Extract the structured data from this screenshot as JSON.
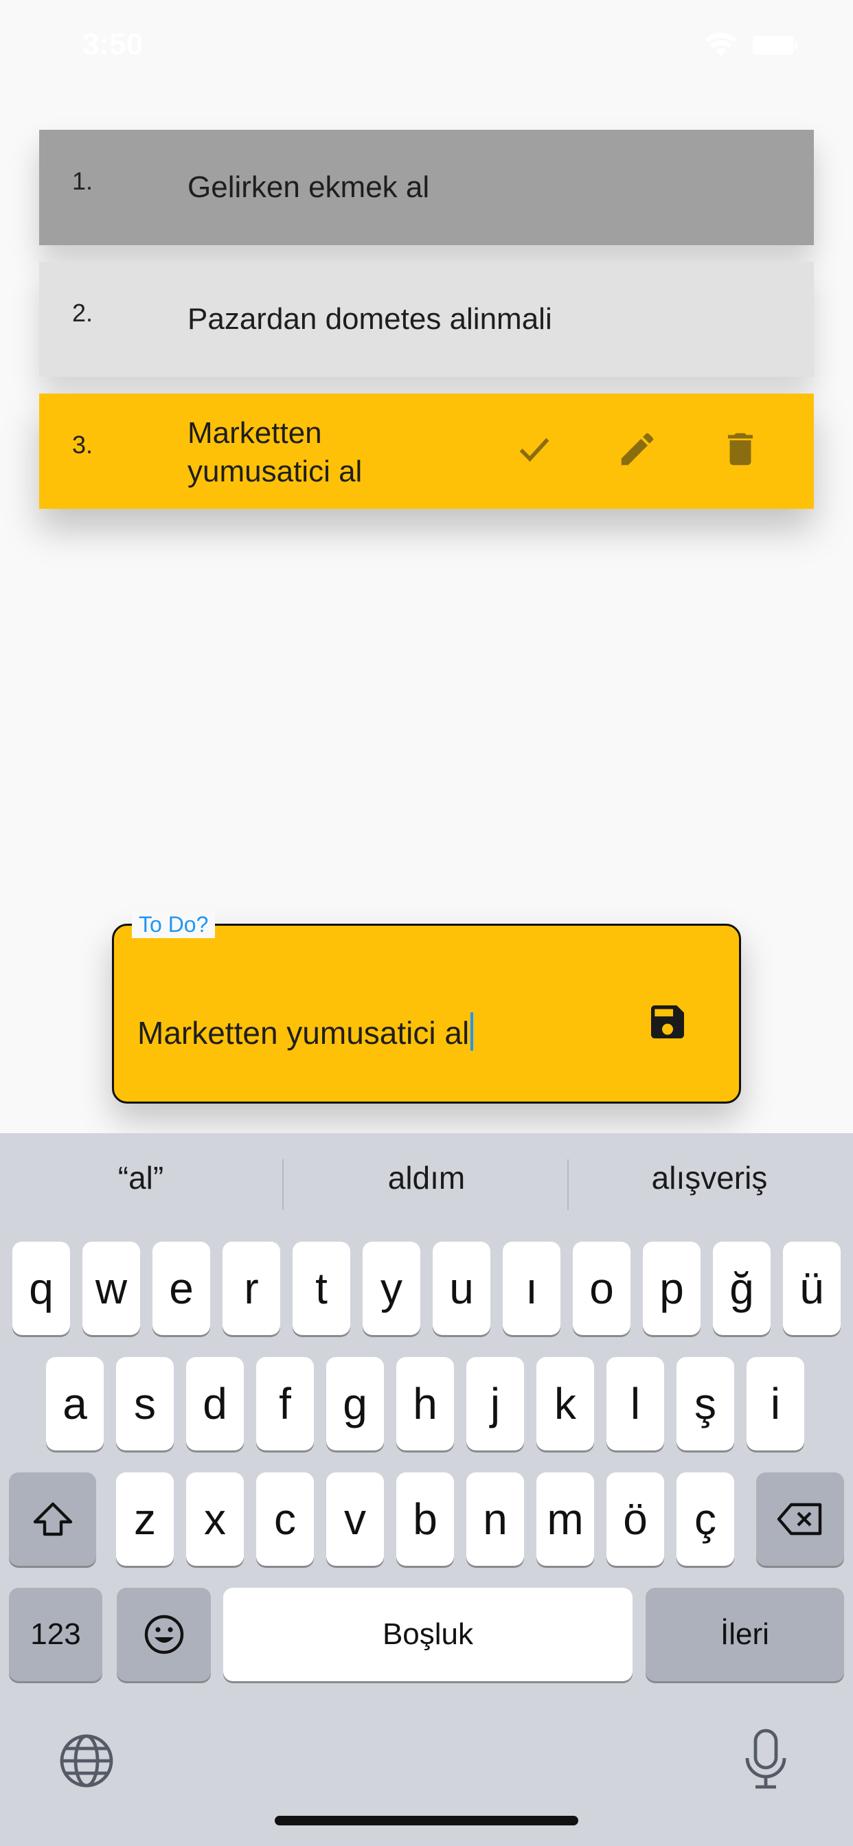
{
  "status_bar": {
    "time": "3:50"
  },
  "todos": [
    {
      "number": "1.",
      "text": "Gelirken ekmek al"
    },
    {
      "number": "2.",
      "text": "Pazardan dometes alinmali"
    },
    {
      "number": "3.",
      "text": "Marketten yumusatici al"
    }
  ],
  "item_actions": [
    "check-icon",
    "pencil-icon",
    "trash-icon"
  ],
  "input": {
    "label": "To Do?",
    "value": "Marketten yumusatici al"
  },
  "keyboard": {
    "suggestions": [
      "“al”",
      "aldım",
      "alışveriş"
    ],
    "row1": [
      "q",
      "w",
      "e",
      "r",
      "t",
      "y",
      "u",
      "ı",
      "o",
      "p",
      "ğ",
      "ü"
    ],
    "row2": [
      "a",
      "s",
      "d",
      "f",
      "g",
      "h",
      "j",
      "k",
      "l",
      "ş",
      "i"
    ],
    "row3": [
      "z",
      "x",
      "c",
      "v",
      "b",
      "n",
      "m",
      "ö",
      "ç"
    ],
    "numbers_key": "123",
    "space_key": "Boşluk",
    "return_key": "İleri"
  },
  "colors": {
    "accent_yellow": "#ffc107",
    "label_blue": "#2196f3",
    "done_gray": "#a0a0a0",
    "pending_gray": "#e1e1e1"
  }
}
